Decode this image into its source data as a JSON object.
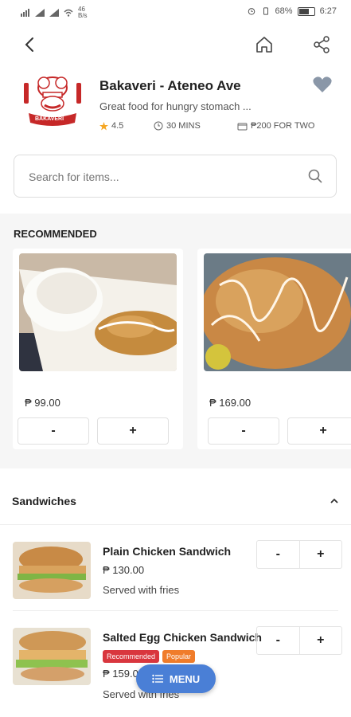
{
  "status_bar": {
    "left": "46 B/s",
    "battery": "68%",
    "time": "6:27"
  },
  "restaurant": {
    "name": "Bakaveri - Ateneo Ave",
    "description": "Great food for hungry stomach ...",
    "rating": "4.5",
    "time": "30 MINS",
    "cost": "₱200 FOR TWO",
    "logo_text": "BAKAVERI"
  },
  "search": {
    "placeholder": "Search for items..."
  },
  "recommended": {
    "title": "RECOMMENDED",
    "items": [
      {
        "price": "₱ 99.00",
        "minus": "-",
        "plus": "+"
      },
      {
        "price": "₱ 169.00",
        "minus": "-",
        "plus": "+"
      }
    ]
  },
  "section": {
    "title": "Sandwiches"
  },
  "items": [
    {
      "name": "Plain Chicken Sandwich",
      "price": "₱ 130.00",
      "note": "Served with fries",
      "minus": "-",
      "plus": "+"
    },
    {
      "name": "Salted Egg Chicken Sandwich",
      "price": "₱ 159.00",
      "note": "Served with fries",
      "minus": "-",
      "plus": "+",
      "badges": [
        "Recommended",
        "Popular"
      ]
    }
  ],
  "menu_button": {
    "label": "MENU"
  },
  "colors": {
    "accent": "#4a7fd6",
    "badge_recommended": "#d9363e",
    "badge_popular": "#f07c2a",
    "star": "#f5a623"
  }
}
